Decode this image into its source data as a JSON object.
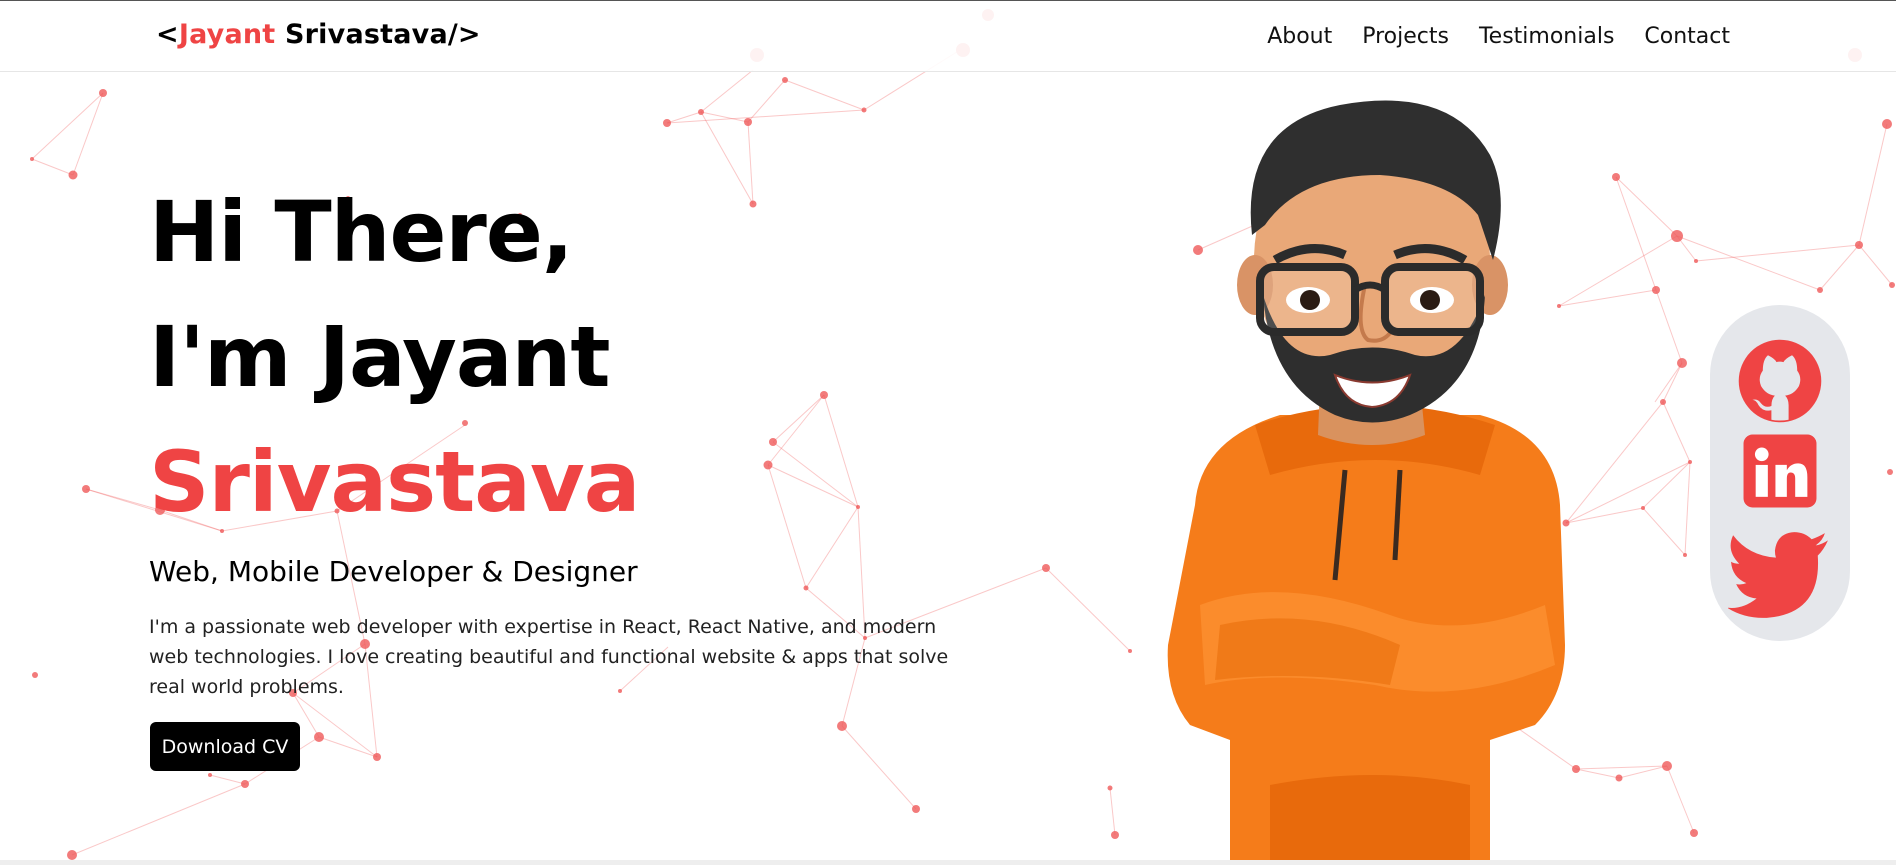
{
  "logo": {
    "open": "<",
    "first": "Jayant",
    "last": " Srivastava",
    "close": "/>"
  },
  "nav": {
    "items": [
      "About",
      "Projects",
      "Testimonials",
      "Contact"
    ]
  },
  "hero": {
    "line1": "Hi There,",
    "line2": "I'm Jayant",
    "line3": "Srivastava",
    "subtitle": "Web, Mobile Developer & Designer",
    "description": "I'm a passionate web developer with expertise in React, React Native, and modern web technologies. I love creating beautiful and functional website & apps that solve real world problems.",
    "cta": "Download CV"
  },
  "social": {
    "icons": [
      "github-icon",
      "linkedin-icon",
      "twitter-icon"
    ]
  },
  "colors": {
    "accent": "#ef4444",
    "button": "#000000",
    "social_bg": "#e5e7eb",
    "hoodie": "#f57c1a"
  }
}
